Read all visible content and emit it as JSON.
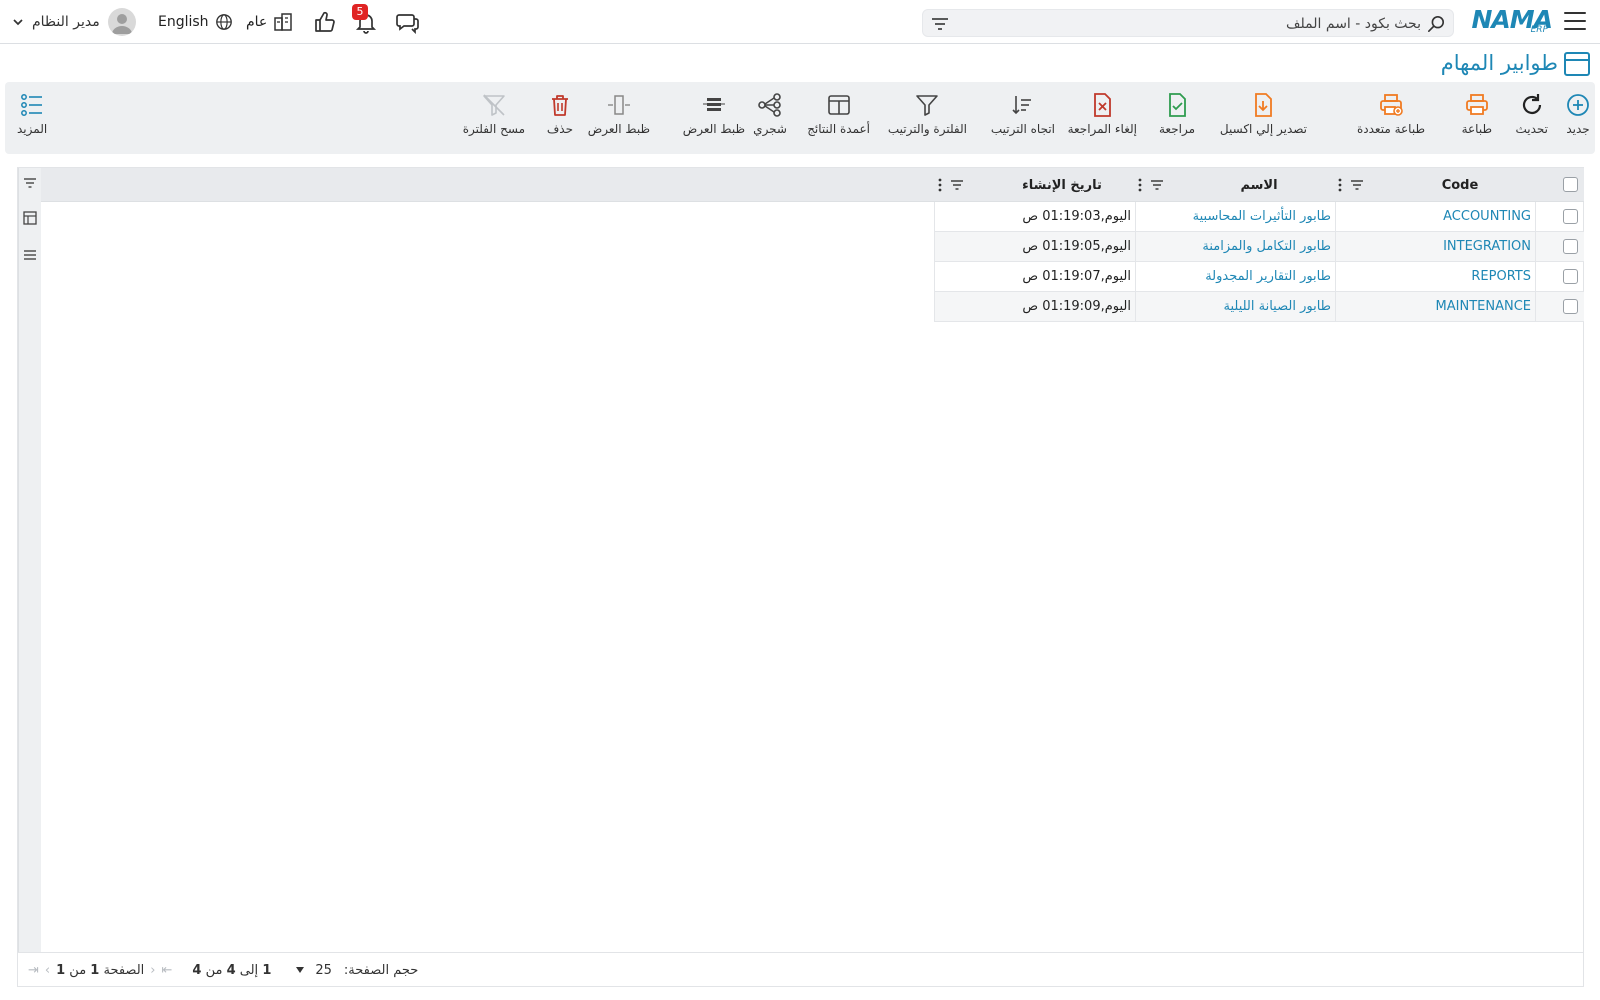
{
  "header": {
    "logo_text": "NAMA",
    "logo_sub": "ERP",
    "search_placeholder": "بحث بكود - اسم الملف",
    "notifications_count": "5",
    "branch_label": "عام",
    "language_label": "English",
    "user_name": "مدير النظام"
  },
  "page": {
    "title": "طوابير المهام"
  },
  "toolbar": {
    "new": "جديد",
    "refresh": "تحديث",
    "print": "طباعة",
    "multi_print": "طباعة متعددة",
    "export_excel": "تصدير إلي اكسيل",
    "review": "مراجعة",
    "cancel_review": "إلغاء المراجعة",
    "sort_direction": "اتجاه الترتيب",
    "filter_sort": "الفلترة والترتيب",
    "result_columns": "أعمدة النتائج",
    "tree": "شجري",
    "display_setting_1": "ظبط العرض",
    "display_setting_2": "ظبط العرض",
    "delete": "حذف",
    "clear_filter": "مسح الفلترة",
    "more": "المزيد"
  },
  "table": {
    "columns": {
      "code": "Code",
      "name": "الاسم",
      "created": "تاريخ الإنشاء"
    },
    "rows": [
      {
        "code": "ACCOUNTING",
        "name": "طابور التأثيرات المحاسبية",
        "created": "اليوم,01:19:03 ص"
      },
      {
        "code": "INTEGRATION",
        "name": "طابور التكامل والمزامنة",
        "created": "اليوم,01:19:05 ص"
      },
      {
        "code": "REPORTS",
        "name": "طابور التقارير المجدولة",
        "created": "اليوم,01:19:07 ص"
      },
      {
        "code": "MAINTENANCE",
        "name": "طابور الصيانة الليلية",
        "created": "اليوم,01:19:09 ص"
      }
    ]
  },
  "footer": {
    "page_size_label": "حجم الصفحة:",
    "page_size": "25",
    "range_from": "1",
    "range_to_label": "إلى",
    "range_to": "4",
    "of_label": "من",
    "total": "4",
    "page_label": "الصفحة",
    "page_current": "1",
    "page_of_label": "من",
    "page_total": "1"
  },
  "colors": {
    "accent": "#1e87b5",
    "orange": "#f07b22",
    "green": "#2e9c4f",
    "red": "#c0392b",
    "badge": "#e02424"
  }
}
